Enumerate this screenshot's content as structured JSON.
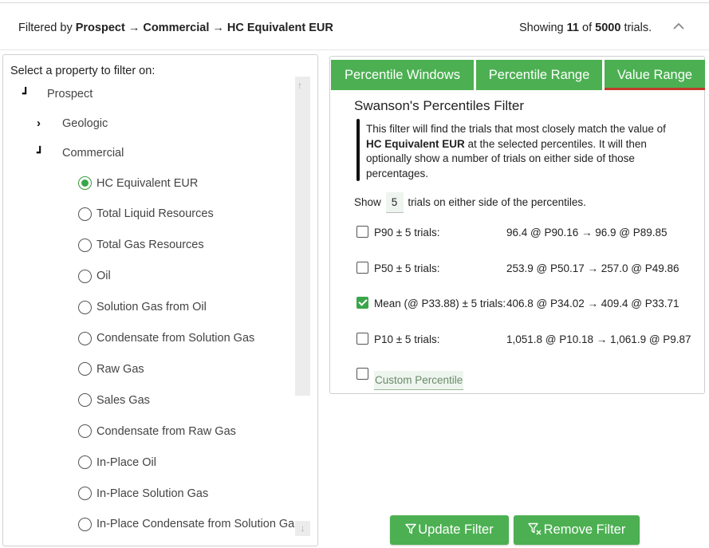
{
  "header": {
    "filtered_prefix": "Filtered by",
    "filtered_path": "Prospect → Commercial → HC Equivalent EUR",
    "showing_prefix": "Showing",
    "showing_count": "11",
    "showing_of": "of",
    "showing_total": "5000",
    "showing_suffix": "trials.",
    "collapse_icon": "chevron-up-icon"
  },
  "tree": {
    "label": "Select a property to filter on:",
    "root": "Prospect",
    "geologic": "Geologic",
    "commercial": "Commercial",
    "properties": [
      "HC Equivalent EUR",
      "Total Liquid Resources",
      "Total Gas Resources",
      "Oil",
      "Solution Gas from Oil",
      "Condensate from Solution Gas",
      "Raw Gas",
      "Sales Gas",
      "Condensate from Raw Gas",
      "In-Place Oil",
      "In-Place Solution Gas",
      "In-Place Condensate from Solution Gas"
    ],
    "selected_index": 0
  },
  "tabs": {
    "windows": "Percentile Windows",
    "range": "Percentile Range",
    "value_range": "Value Range",
    "active": "value_range"
  },
  "filter": {
    "title": "Swanson's Percentiles Filter",
    "desc_1": "This filter will find the trials that most closely match the value of",
    "desc_bold": "HC Equivalent EUR",
    "desc_2": "at the selected percentiles. It will then optionally show a number of trials on either side of those percentages.",
    "show_prefix": "Show",
    "show_value": "5",
    "show_suffix": "trials on either side of the percentiles.",
    "rows": [
      {
        "label": "P90 ± 5 trials:",
        "value": "96.4 @ P90.16 → 96.9 @ P89.85",
        "checked": false
      },
      {
        "label": "P50 ± 5 trials:",
        "value": "253.9 @ P50.17 → 257.0 @ P49.86",
        "checked": false
      },
      {
        "label": "Mean (@ P33.88) ± 5 trials:",
        "value": "406.8 @ P34.02 → 409.4 @ P33.71",
        "checked": true
      },
      {
        "label": "P10 ± 5 trials:",
        "value": "1,051.8 @ P10.18 → 1,061.9 @ P9.87",
        "checked": false
      }
    ],
    "custom_placeholder": "Custom Percentile"
  },
  "buttons": {
    "update": "Update Filter",
    "remove": "Remove Filter"
  },
  "colors": {
    "accent_green": "#4cb052",
    "active_tab_underline": "#c0392b"
  }
}
